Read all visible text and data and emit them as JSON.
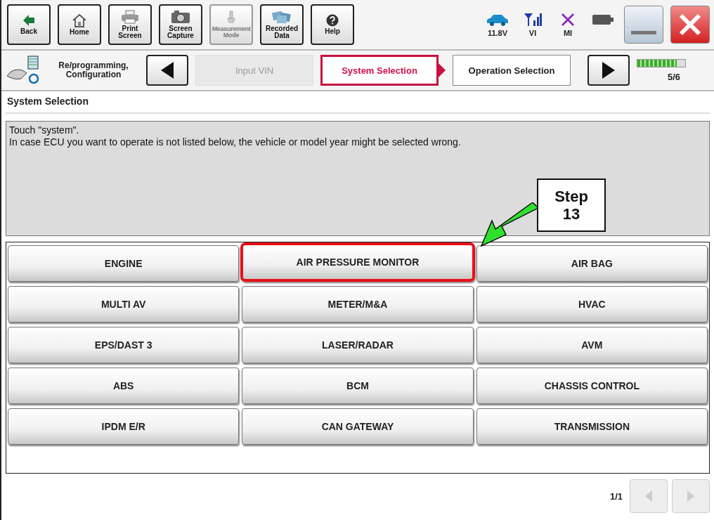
{
  "toolbar": {
    "buttons": [
      {
        "kind": "back",
        "label": "Back",
        "disabled": false
      },
      {
        "kind": "home",
        "label": "Home",
        "disabled": false
      },
      {
        "kind": "print",
        "label": "Print Screen",
        "disabled": false
      },
      {
        "kind": "camera",
        "label": "Screen Capture",
        "disabled": false
      },
      {
        "kind": "measure",
        "label": "Measurement Mode",
        "disabled": true
      },
      {
        "kind": "recorded",
        "label": "Recorded Data",
        "disabled": false
      },
      {
        "kind": "help",
        "label": "Help",
        "disabled": false
      }
    ],
    "status": [
      {
        "kind": "car",
        "label": "11.8V"
      },
      {
        "kind": "signal",
        "label": "VI"
      },
      {
        "kind": "cross",
        "label": "MI"
      },
      {
        "kind": "battery"
      }
    ]
  },
  "breadcrumb": {
    "mode": "Re/programming, Configuration",
    "steps": [
      {
        "label": "Input VIN",
        "selected": false,
        "disabled": true
      },
      {
        "label": "System Selection",
        "selected": true,
        "disabled": false
      },
      {
        "label": "Operation Selection",
        "selected": false,
        "disabled": false
      }
    ],
    "progress": {
      "level": 0.83,
      "text": "5/6"
    }
  },
  "section_title": "System Selection",
  "message": [
    "Touch \"system\".",
    "In case ECU you want to operate is not listed below, the vehicle or model year might be selected wrong."
  ],
  "systems": [
    {
      "label": "ENGINE",
      "highlighted": false
    },
    {
      "label": "AIR PRESSURE MONITOR",
      "highlighted": true
    },
    {
      "label": "AIR BAG",
      "highlighted": false
    },
    {
      "label": "MULTI AV",
      "highlighted": false
    },
    {
      "label": "METER/M&A",
      "highlighted": false
    },
    {
      "label": "HVAC",
      "highlighted": false
    },
    {
      "label": "EPS/DAST 3",
      "highlighted": false
    },
    {
      "label": "LASER/RADAR",
      "highlighted": false
    },
    {
      "label": "AVM",
      "highlighted": false
    },
    {
      "label": "ABS",
      "highlighted": false
    },
    {
      "label": "BCM",
      "highlighted": false
    },
    {
      "label": "CHASSIS CONTROL",
      "highlighted": false
    },
    {
      "label": "IPDM E/R",
      "highlighted": false
    },
    {
      "label": "CAN GATEWAY",
      "highlighted": false
    },
    {
      "label": "TRANSMISSION",
      "highlighted": false
    }
  ],
  "callout": {
    "text": "Step 13"
  },
  "pager": {
    "text": "1/1",
    "prev_disabled": true,
    "next_disabled": true
  }
}
